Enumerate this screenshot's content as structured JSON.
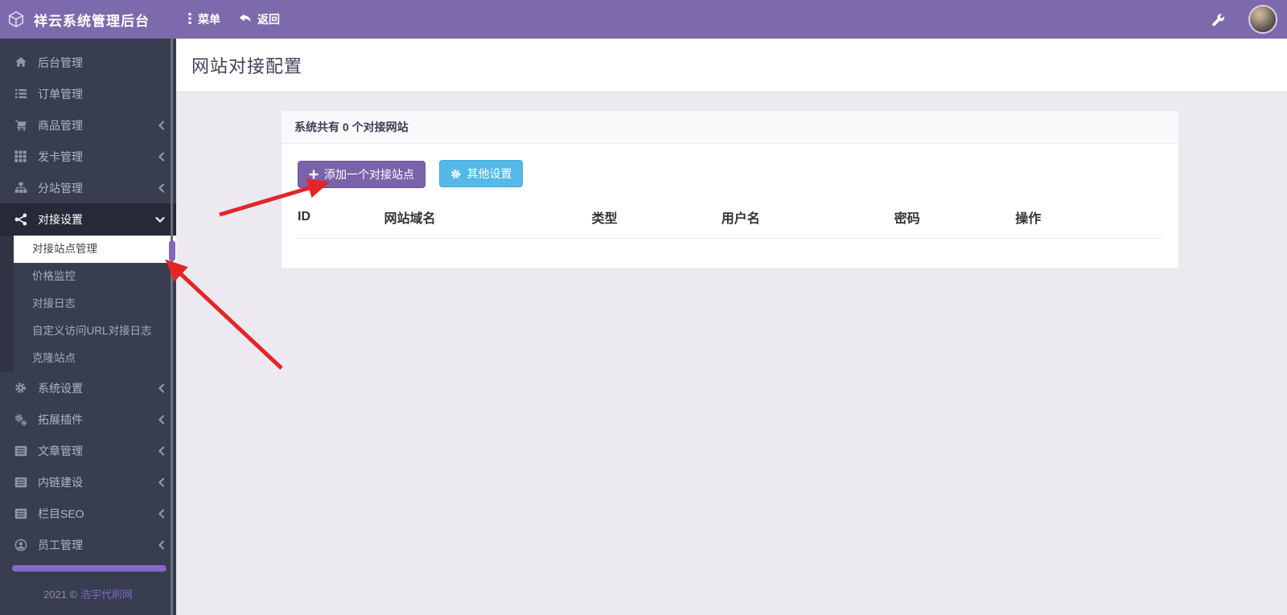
{
  "header": {
    "brand_title": "祥云系统管理后台",
    "menu_label": "菜单",
    "back_label": "返回"
  },
  "sidebar": {
    "items": [
      {
        "label": "后台管理",
        "icon": "home-icon",
        "has_children": false
      },
      {
        "label": "订单管理",
        "icon": "list-icon",
        "has_children": false
      },
      {
        "label": "商品管理",
        "icon": "cart-icon",
        "has_children": true
      },
      {
        "label": "发卡管理",
        "icon": "grid-icon",
        "has_children": true
      },
      {
        "label": "分站管理",
        "icon": "sitemap-icon",
        "has_children": true
      },
      {
        "label": "对接设置",
        "icon": "share-nodes-icon",
        "has_children": true,
        "expanded": true
      },
      {
        "label": "系统设置",
        "icon": "gear-icon",
        "has_children": true
      },
      {
        "label": "拓展插件",
        "icon": "gears-icon",
        "has_children": true
      },
      {
        "label": "文章管理",
        "icon": "article-icon",
        "has_children": true
      },
      {
        "label": "内链建设",
        "icon": "article-icon",
        "has_children": true
      },
      {
        "label": "栏目SEO",
        "icon": "article-icon",
        "has_children": true
      },
      {
        "label": "员工管理",
        "icon": "user-circle-icon",
        "has_children": true
      }
    ],
    "submenu": [
      {
        "label": "对接站点管理",
        "active": true
      },
      {
        "label": "价格监控",
        "active": false
      },
      {
        "label": "对接日志",
        "active": false
      },
      {
        "label": "自定义访问URL对接日志",
        "active": false
      },
      {
        "label": "克隆站点",
        "active": false
      }
    ],
    "footer": {
      "copyright": "2021 ©",
      "site_link": "浩宇代刷网"
    }
  },
  "main": {
    "page_title": "网站对接配置",
    "panel": {
      "summary": "系统共有 0 个对接网站",
      "add_site_button": "添加一个对接站点",
      "other_settings_button": "其他设置",
      "columns": [
        "ID",
        "网站域名",
        "类型",
        "用户名",
        "密码",
        "操作"
      ],
      "rows": []
    }
  },
  "colors": {
    "topbar_purple": "#7c6aad",
    "sidebar_dark": "#383d50",
    "button_purple": "#7a63ab",
    "button_blue": "#56b8e8",
    "footer_bar_purple": "#8767c9",
    "annotation_arrow_red": "#e32528"
  }
}
